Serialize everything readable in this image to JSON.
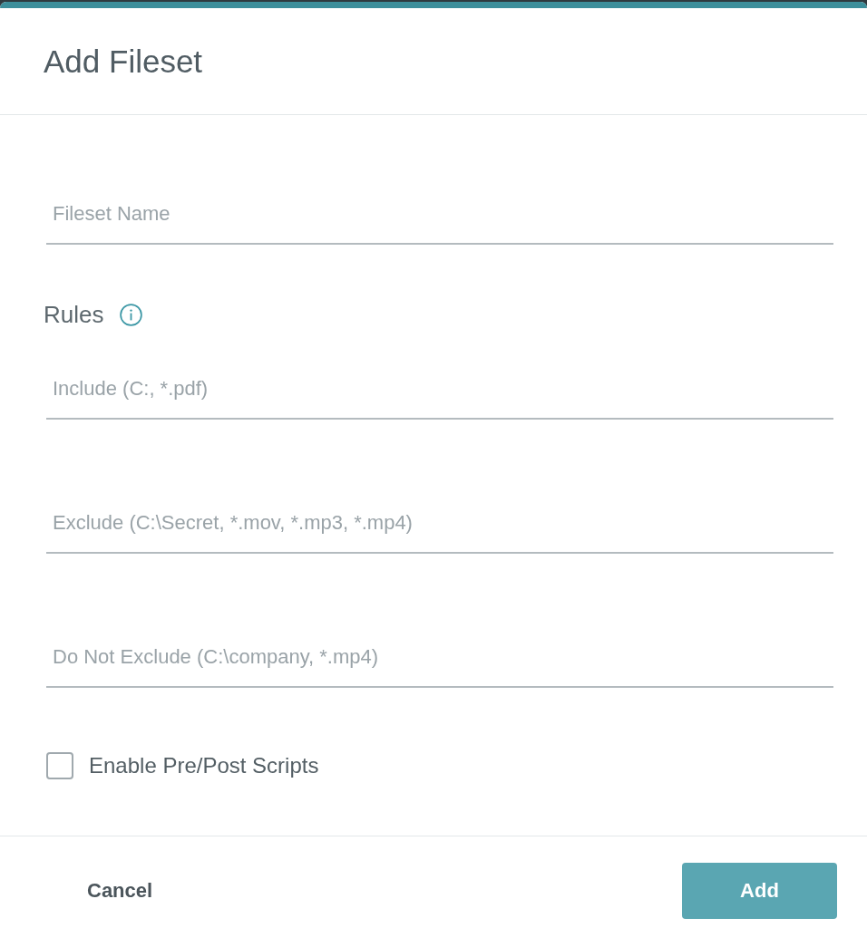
{
  "dialog": {
    "title": "Add Fileset"
  },
  "name_field": {
    "placeholder": "Fileset Name"
  },
  "rules": {
    "label": "Rules",
    "fields": [
      {
        "placeholder": "Include (C:, *.pdf)"
      },
      {
        "placeholder": "Exclude (C:\\Secret, *.mov, *.mp3, *.mp4)"
      },
      {
        "placeholder": "Do Not Exclude (C:\\company, *.mp4)"
      }
    ]
  },
  "options": [
    {
      "label": "Enable Pre/Post Scripts",
      "checked": false
    }
  ],
  "buttons": [
    {
      "label": "Cancel",
      "kind": "text",
      "disabled": false
    },
    {
      "label": "Add",
      "kind": "primary",
      "disabled": true
    }
  ]
}
